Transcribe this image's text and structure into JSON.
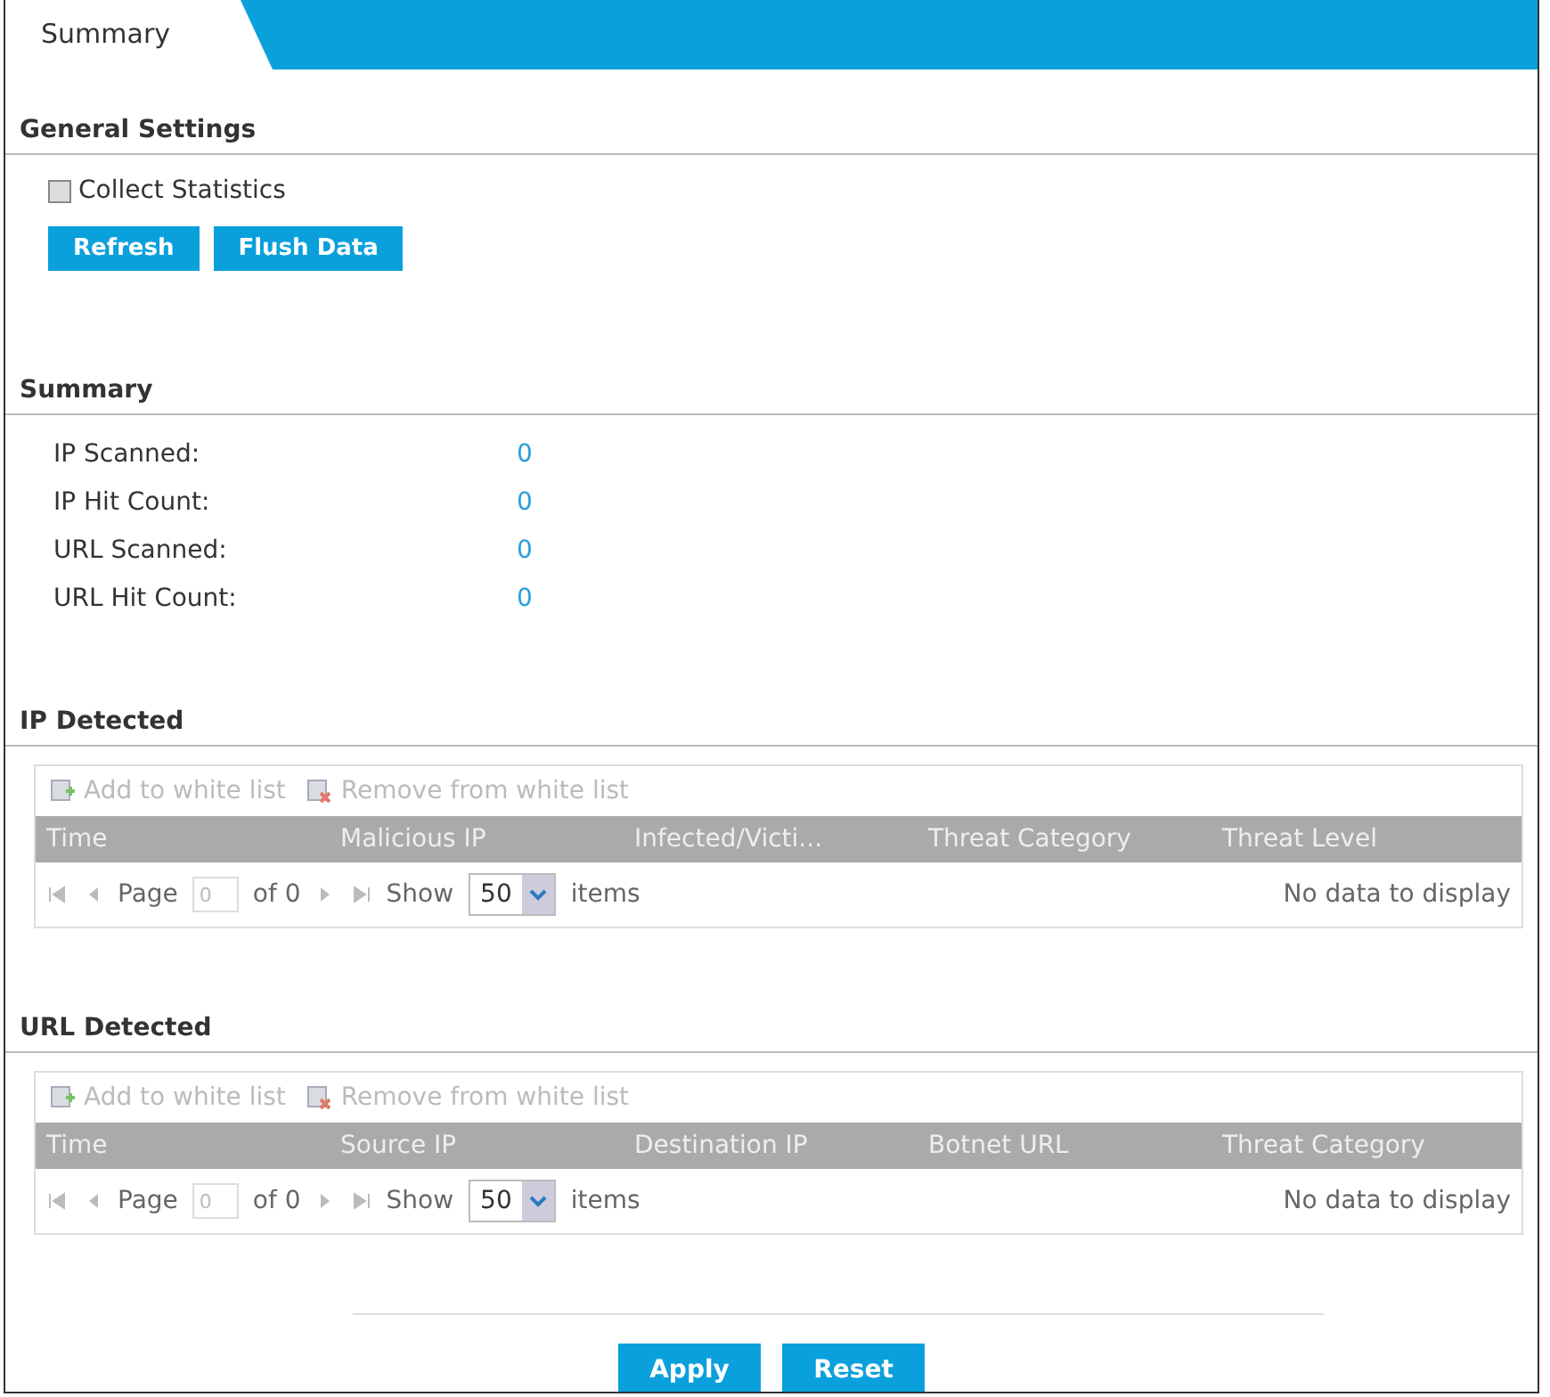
{
  "tabs": [
    {
      "label": "Summary",
      "selected": true
    }
  ],
  "general_settings": {
    "title": "General Settings",
    "collect_statistics": {
      "label": "Collect Statistics",
      "checked": false
    },
    "buttons": [
      "Refresh",
      "Flush Data"
    ]
  },
  "summary": {
    "title": "Summary",
    "rows": [
      {
        "label": "IP Scanned:",
        "value": "0"
      },
      {
        "label": "IP Hit Count:",
        "value": "0"
      },
      {
        "label": "URL Scanned:",
        "value": "0"
      },
      {
        "label": "URL Hit Count:",
        "value": "0"
      }
    ]
  },
  "tables": [
    {
      "title": "IP Detected",
      "toolbar": [
        {
          "label": "Add to white list",
          "kind": "add",
          "disabled": true
        },
        {
          "label": "Remove from white list",
          "kind": "remove",
          "disabled": true
        }
      ],
      "columns": [
        "Time",
        "Malicious IP",
        "Infected/Victi...",
        "Threat Category",
        "Threat Level"
      ],
      "pager": {
        "page_label": "Page",
        "page": "0",
        "of": "of 0",
        "show_label": "Show",
        "show": "50",
        "items_label": "items",
        "status": "No data to display"
      }
    },
    {
      "title": "URL Detected",
      "toolbar": [
        {
          "label": "Add to white list",
          "kind": "add",
          "disabled": true
        },
        {
          "label": "Remove from white list",
          "kind": "remove",
          "disabled": true
        }
      ],
      "columns": [
        "Time",
        "Source IP",
        "Destination IP",
        "Botnet URL",
        "Threat Category"
      ],
      "pager": {
        "page_label": "Page",
        "page": "0",
        "of": "of 0",
        "show_label": "Show",
        "show": "50",
        "items_label": "items",
        "status": "No data to display"
      }
    }
  ],
  "footer_buttons": [
    "Apply",
    "Reset"
  ]
}
